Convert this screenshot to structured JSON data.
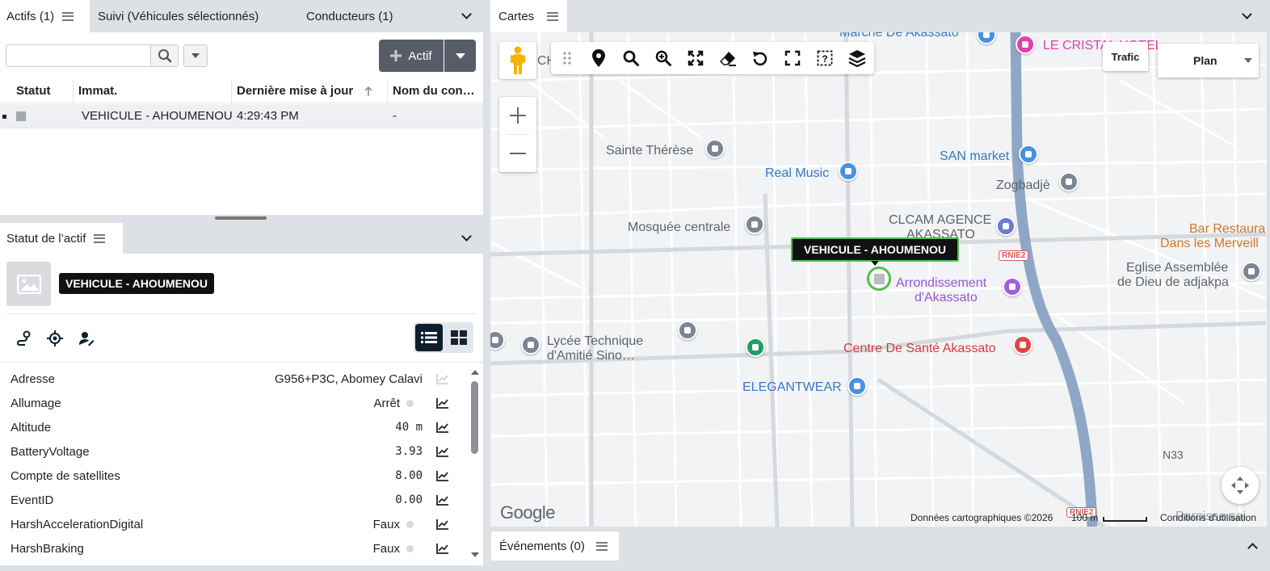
{
  "assets_panel": {
    "tabs": [
      {
        "label": "Actifs (1)"
      },
      {
        "label": "Suivi (Véhicules sélectionnés)"
      },
      {
        "label": "Conducteurs (1)"
      }
    ],
    "search": {
      "value": "",
      "placeholder": ""
    },
    "add_button_label": "Actif",
    "columns": [
      "Statut",
      "Immat.",
      "Dernière mise à jour",
      "Nom du con…"
    ],
    "rows": [
      {
        "status": "",
        "plate": "VEHICULE - AHOUMENOU",
        "last_update": "4:29:43 PM",
        "driver": "-"
      }
    ]
  },
  "status_panel": {
    "tab_label": "Statut de l’actif",
    "asset_name": "VEHICULE - AHOUMENOU",
    "properties": [
      {
        "key": "Adresse",
        "value": "G956+P3C, Abomey Calavi"
      },
      {
        "key": "Allumage",
        "value": "Arrêt"
      },
      {
        "key": "Altitude",
        "value": "40 m"
      },
      {
        "key": "BatteryVoltage",
        "value": "3.93"
      },
      {
        "key": "Compte de satellites",
        "value": "8.00"
      },
      {
        "key": "EventID",
        "value": "0.00"
      },
      {
        "key": "HarshAccelerationDigital",
        "value": "Faux"
      },
      {
        "key": "HarshBraking",
        "value": "Faux"
      }
    ]
  },
  "map_panel": {
    "tab_label": "Cartes",
    "toolbar_partial_text": "CH",
    "traffic_label": "Trafic",
    "map_type": "Plan",
    "vehicle_label": "VEHICULE - AHOUMENOU",
    "pois": {
      "marche": "Marche De Akassato",
      "cristal": "LE CRISTAL HOTEL",
      "sainte_therese": "Sainte Thérèse",
      "real_music": "Real Music",
      "san_market": "SAN market",
      "zogbadje": "Zogbadjè",
      "clcam1": "CLCAM AGENCE",
      "clcam2": "AKASSATO",
      "mosquee": "Mosquée centrale",
      "bar1": "Bar Restaura",
      "bar2": "Dans les Merveill",
      "eglise1": "Eglise Assemblée",
      "eglise2": "de Dieu de adjakpa",
      "arrond1": "Arrondissement",
      "arrond2": "d'Akassato",
      "lycee1": "Lycée Technique",
      "lycee2": "d'Amitié Sino…",
      "centre_sante": "Centre De Santé Akassato",
      "elegantwear": "ELEGANTWEAR",
      "n33": "N33",
      "rnie2": "RNIE2",
      "paroisse": "Paroisse sai"
    },
    "google": "Google",
    "attribution": "Données cartographiques ©2026",
    "scale": "100 m",
    "terms": "Conditions d'utilisation"
  },
  "events_panel": {
    "tab_label": "Événements (0)"
  },
  "colors": {
    "vehicle_outline": "#4fc04f",
    "panel_bg": "#dde0e5",
    "dark_button": "#575d68",
    "toggle_active": "#0f1e2e",
    "highway": "#8fa6c6"
  }
}
